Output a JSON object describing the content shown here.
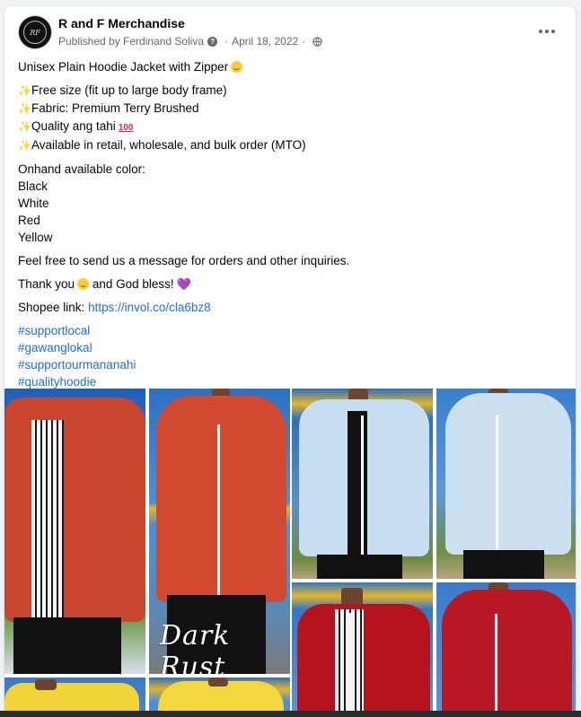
{
  "post": {
    "page_name": "R and F Merchandise",
    "avatar_text": "RF",
    "published_by": "Published by Ferdinand Soliva",
    "info_glyph": "?",
    "separator": "·",
    "date": "April 18, 2022",
    "globe_glyph": "🌐"
  },
  "content": {
    "title": "Unisex Plain Hoodie Jacket with Zipper",
    "features": [
      "Free size (fit up to large body frame)",
      "Fabric: Premium Terry Brushed",
      "Quality ang tahi",
      "Available in retail, wholesale, and bulk order (MTO)"
    ],
    "colors_header": "Onhand available color:",
    "colors": [
      "Black",
      "White",
      "Red",
      "Yellow"
    ],
    "message_line": "Feel free to send us a message for orders and other inquiries.",
    "thanks_before": "Thank you",
    "thanks_after": "and God bless!",
    "shopee_label": "Shopee link:",
    "shopee_url": "https://invol.co/cla6bz8",
    "hashtags": [
      "#supportlocal",
      "#gawanglokal",
      "#supportourmananahi",
      "#qualityhoodie"
    ]
  },
  "icons": {
    "sparkle": "✨",
    "heart": "💜",
    "hundred": "100"
  },
  "photos": {
    "caption_dark_rust": "Dark Rust"
  },
  "colors": {
    "link": "#216fdb",
    "rust": "#c8462f",
    "sky_blue": "#c6def0",
    "red": "#b5141f",
    "yellow": "#f2d338"
  }
}
